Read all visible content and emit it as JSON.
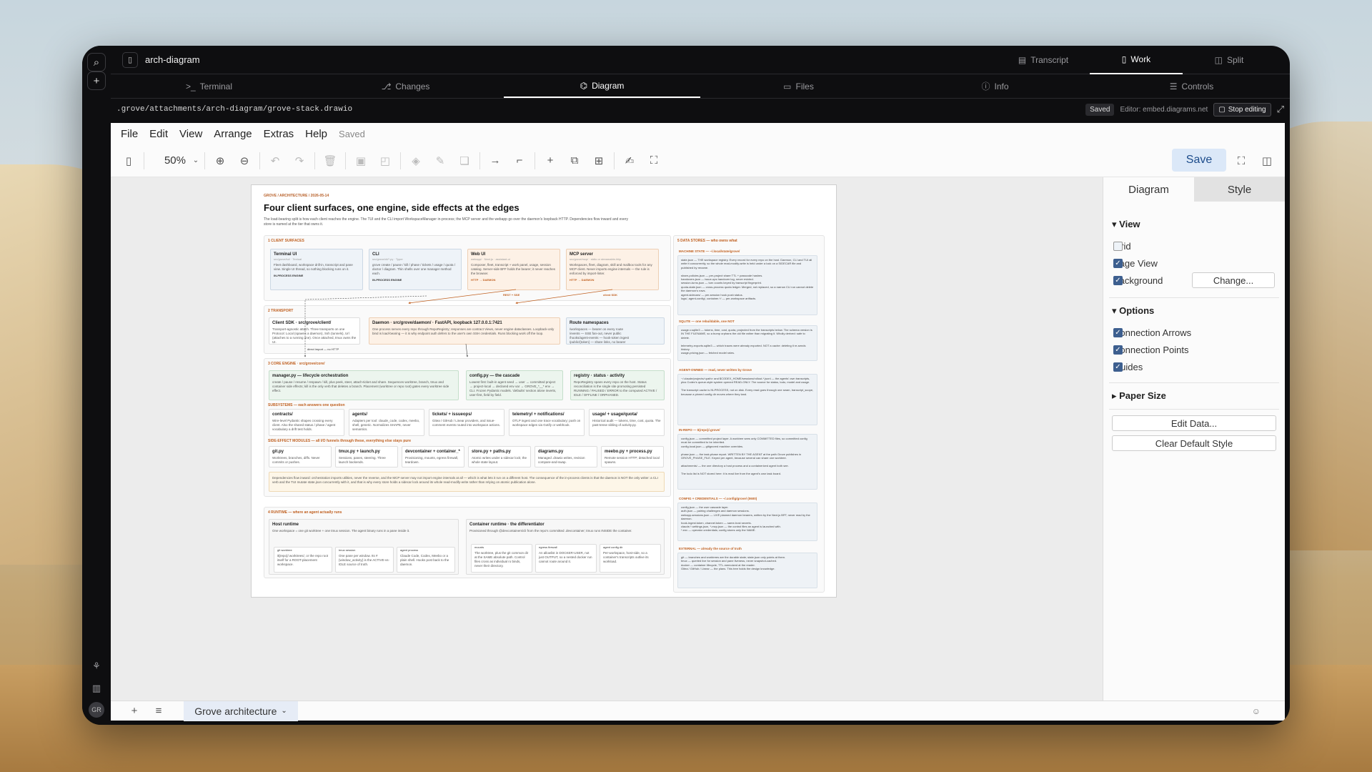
{
  "window": {
    "title": "arch-diagram"
  },
  "rail": {
    "avatar": "GR"
  },
  "modes": [
    {
      "label": "Transcript",
      "icon": "transcript-icon"
    },
    {
      "label": "Work",
      "icon": "work-icon",
      "active": true
    },
    {
      "label": "Split",
      "icon": "split-icon"
    }
  ],
  "tabs": [
    {
      "label": "Terminal",
      "icon": "terminal-icon"
    },
    {
      "label": "Changes",
      "icon": "changes-icon"
    },
    {
      "label": "Diagram",
      "icon": "diagram-icon",
      "active": true
    },
    {
      "label": "Files",
      "icon": "files-icon"
    },
    {
      "label": "Info",
      "icon": "info-icon"
    },
    {
      "label": "Controls",
      "icon": "controls-icon"
    }
  ],
  "pathbar": {
    "path": ".grove/attachments/arch-diagram/grove-stack.drawio",
    "saved": "Saved",
    "editor": "Editor: embed.diagrams.net",
    "stop": "Stop editing"
  },
  "menu": {
    "items": [
      "File",
      "Edit",
      "View",
      "Arrange",
      "Extras",
      "Help"
    ],
    "status": "Saved"
  },
  "toolbar": {
    "zoom": "50%",
    "save": "Save"
  },
  "panel": {
    "tabs": [
      "Diagram",
      "Style"
    ],
    "view_title": "View",
    "grid": "Grid",
    "page_view": "Page View",
    "background": "Background",
    "change": "Change...",
    "options_title": "Options",
    "conn_arrows": "Connection Arrows",
    "conn_points": "Connection Points",
    "guides": "Guides",
    "paper_size": "Paper Size",
    "edit_data": "Edit Data...",
    "clear_style": "Clear Default Style"
  },
  "checkboxes": {
    "grid": false,
    "page_view": true,
    "background": true,
    "conn_arrows": true,
    "conn_points": true,
    "guides": true
  },
  "page_tab": "Grove architecture",
  "diagram": {
    "kicker": "GROVE / ARCHITECTURE / 2026-05-14",
    "title": "Four client surfaces, one engine, side effects at the edges",
    "desc": "The load-bearing split is how each client reaches the engine. The TUI and the CLI import WorkspaceManager in-process; the MCP server and the webapp go over the daemon's loopback HTTP. Dependencies flow inward and every store is named at the tier that owns it.",
    "s1": "1 CLIENT SURFACES",
    "s2": "2 TRANSPORT",
    "s3": "3 CORE ENGINE · src/grove/core/",
    "s4": "4 RUNTIME — where an agent actually runs",
    "s5": "5 DATA STORES — who owns what",
    "sub1": "SUBSYSTEMS — each answers one question",
    "sub2": "SIDE-EFFECT MODULES — all I/O funnels through these, everything else stays pure",
    "tui": {
      "t": "Terminal UI",
      "s": "src/grove/tui/ · Textual",
      "d": "Fleet dashboard, workspace drill-in, transcript and pane view. Single UI thread, so nothing blocking runs on it.",
      "f": "IN-PROCESS ENGINE"
    },
    "cli": {
      "t": "CLI",
      "s": "src/grove/cli/*.py · Typer",
      "d": "grove create / pause / kill / phase / tickets / usage / quota / doctor / diagram. Thin shells over one manager method each.",
      "f": "IN-PROCESS ENGINE"
    },
    "web": {
      "t": "Web UI",
      "s": "webapp/ · Next.js · assistant-ui",
      "d": "Composer, fleet, transcript + work panel, usage, session catalog. Server-side BFF holds the bearer; it never reaches the browser.",
      "f": "HTTP → DAEMON"
    },
    "mcp": {
      "t": "MCP server",
      "s": "src/grove/mcp/ · stdio or streamable-http",
      "d": "Workspaces, fleet, diagram, skill and mailbox tools for any MCP client. Never imports engine internals — the rule is enforced by import-linter.",
      "f": "HTTP → DAEMON"
    },
    "rest": "REST + SSE",
    "client_sdk": "client SDK",
    "sdk": {
      "t": "Client SDK · src/grove/client/",
      "d": "Transport-agnostic attach. Three transports on one Protocol: Local (spawns a daemon), Ssh (tunnels), Url (attaches to a running one). Once attached, tmux owns the UI."
    },
    "daemon": {
      "t": "Daemon · src/grove/daemon/ · FastAPI, loopback 127.0.0.1:7421",
      "d": "One process serves every repo through RepoRegistry; responses are contract Views, never engine dataclasses. Loopback-only bind is load-bearing — it is why endpoint auth defers to the user's own SSH credentials. Runs blocking work off the loop."
    },
    "routes": {
      "t": "Route namespaces",
      "d": "/workspaces — bearer on every route\n/events — SSE fan-out, never public\n/hooks/agent-events — hook-token ingest\n/public/{token} — share links, no bearer"
    },
    "direct": "direct import — no HTTP",
    "mgr": {
      "t": "manager.py — lifecycle orchestration",
      "d": "create / pause / resume / respawn / kill, plus peek, steer, attach-ticket and share. Sequences worktree, branch, tmux and container side effects; kill is the only verb that deletes a branch. Placement (worktree or repo root) gates every worktree side effect."
    },
    "cfg": {
      "t": "config.py — the cascade",
      "d": "Lowest first: built-in agent seed → user → committed project → project-local → declared env var → GROVE_*__* env → CLI. Frozen Pydantic models. 'defaults' section alone inverts, user-first, field by field."
    },
    "reg": {
      "t": "registry · status · activity",
      "d": "RepoRegistry spans every repo on the host. Status reconciliation is the single site promoting persisted RUNNING / PAUSED / ERROR to the computed ACTIVE / IDLE / OFFLINE / ORPHANED."
    },
    "subs": [
      {
        "t": "contracts/",
        "d": "Wire-level Pydantic shapes crossing every client. Also the shared status / phase / agent vocabulary a drift test holds."
      },
      {
        "t": "agents/",
        "d": "Adapters per tool: claude_code, codex, meebo, shell, generic. Normalizes SHAPE, never semantics."
      },
      {
        "t": "tickets/ + issueops/",
        "d": "Gitea / GitHub / Linear providers, and issue-comment events routed into workspace actions."
      },
      {
        "t": "telemetry/ + notifications/",
        "d": "OTLP ingest and one trace vocabulary; push on workspace edges via Gotify or webhook."
      },
      {
        "t": "usage/ + usage/quota/",
        "d": "Historical audit — tokens, time, cost, quota. The past-tense sibling of activity.py."
      }
    ],
    "mods": [
      {
        "t": "git.py",
        "d": "Worktrees, branches, diffs. Never commits or pushes."
      },
      {
        "t": "tmux.py + launch.py",
        "d": "Sessions, panes, steering. Three launch backends."
      },
      {
        "t": "devcontainer + container_*",
        "d": "Provisioning, mounts, egress firewall, teardown."
      },
      {
        "t": "store.py + paths.py",
        "d": "Atomic writes under a sidecar lock; the whole state layout."
      },
      {
        "t": "diagrams.py",
        "d": "Managed .drawio writes, revision compare-and-swap."
      },
      {
        "t": "meebo.py + process.py",
        "d": "Remote session HTTP; detached local spawns."
      }
    ],
    "note": "Dependencies flow inward: orchestration imports utilities, never the reverse, and the MCP server may not import engine internals at all — which is what lets it run on a different host. The consequence of the in-process clients is that the daemon is NOT the only writer: a CLI verb and the TUI mutate state.json concurrently with it, and that is why every store holds a sidecar lock around its whole read-modify-write rather than relying on atomic publication alone.",
    "host": {
      "t": "Host runtime",
      "d": "One workspace = one git worktree + one tmux session. The agent binary runs in a pane inside it."
    },
    "host_cells": [
      {
        "t": "git worktree",
        "d": "${repo}/.worktrees/, or the repo root itself for a ROOT-placement workspace."
      },
      {
        "t": "tmux session",
        "d": "One pane per window. Its # {window_activity} is the ACTIVE-vs-IDLE source of truth."
      },
      {
        "t": "agent process",
        "d": "Claude Code, Codex, Meebo or a plain shell. Hooks post back to the daemon."
      }
    ],
    "cont": {
      "t": "Container runtime · the differentiator",
      "d": "Provisioned through @devcontainers/cli from the repo's committed .devcontainer; tmux runs INSIDE the container."
    },
    "cont_cells": [
      {
        "t": "mounts",
        "d": "The worktree, plus the git common dir at the SAME absolute path. Control files cross as individual ro binds, never their directory."
      },
      {
        "t": "egress firewall",
        "d": "An allowlist in DOCKER-USER, not just OUTPUT, so a nested docker run cannot route around it."
      },
      {
        "t": "agent config dir",
        "d": "Per-workspace, host-side, so a container's transcripts outlive its workload."
      }
    ],
    "stores": [
      {
        "h": "MACHINE STATE — ~/.local/state/grove/",
        "d": "state.json — THE workspace registry. Every record for every repo on the host. Daemon, CLI and TUI all write it concurrently, so the whole read-modify-write is held under a lock on a SIDECAR file and published by rename.\n\nshare-policies.json — per-project share TTL + passcode hashes.\nhandovers.json — issue-ops handover log, never evicted.\nsession-turns.json — turn counts keyed by transcript fingerprint.\nquota-state.json — cross-process quota ledger. Merged, not replaced, so a narrow CLI run cannot delete the daemon's rows.\nagent-sidecars/ — per-session hook push status.\nlogs/, agent-config/, container-*/ — per-workspace artifacts."
      },
      {
        "h": "SQLITE — one rebuildable, one NOT",
        "d": "usage-v.sqlite3 — tokens, time, cost, quota, projected from the transcripts below. The schema version is IN THE FILENAME, so a bump orphans the old file rather than migrating it. Wholly derived: safe to delete.\n\ntelemetry-exports.sqlite3 — which traces were already exported. NOT a cache: deleting it re-sends history.\nusage-pricing.json — fetched model rates."
      },
      {
        "h": "AGENT-OWNED — read, never written by Grove",
        "d": "~/.claude/projects/<path> and $CODEX_HOME/sessions/rollout-*.jsonl — the agents' own transcripts, plus Codex's queue-style system opened READ-ONLY. The source for status, todo, model and usage.\n\nThe transcript cache is IN-PROCESS, not on disk. Every read goes through one seam, transcript_scope, because a pinned config dir moves where they land."
      },
      {
        "h": "IN-REPO — ${repo}/.grove/",
        "d": "config.json — committed project layer. A worktree sees only COMMITTED files, so committed config must be committed to be inherited.\nconfig.local.json — gitignored machine overrides.\n\nphase.json — the task-phase report. WRITTEN BY THE AGENT at the path Grove publishes in GROVE_PHASE_FILE. Keyed per agent, because several can share one worktree.\n\nattachments/ — the one directory a host process and a containerized agent both see.\n\nThe todo list is NOT stored here: it is read live from the agent's own task board."
      },
      {
        "h": "CONFIG + CREDENTIALS — ~/.config/grove/ (0600)",
        "d": "config.json — the user cascade layer.\nauth.json — pairing challenges and daemon sessions.\nwebapp-sessions.json — LIVE planned daemon bearers, written by the Next.js BFF, never read by the daemon.\nhook-ingest.token, channel.token — same-host secrets.\nclaude-*-settings.json, *-mcp.json — the control files an agent is launched with.\n*.env — operator credentials; config stores only the NAME."
      },
      {
        "h": "EXTERNAL — already the source of truth",
        "d": "git — branches and worktrees are the durable state; state.json only points at them.\ntmux — queried live for session and pane liveness, never snapshot-cached.\ndocker — container lifecycle, TTL-memoized at the reader.\nGitea / GitHub / Linear — the plans. This tree holds the design knowledge."
      }
    ]
  }
}
